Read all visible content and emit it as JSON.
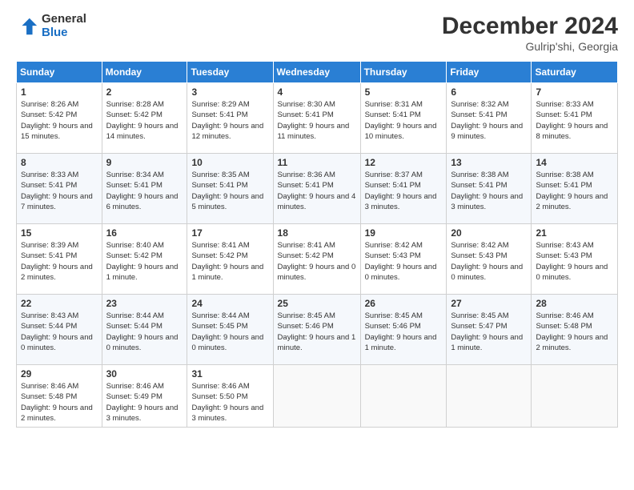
{
  "header": {
    "logo_general": "General",
    "logo_blue": "Blue",
    "month": "December 2024",
    "location": "Gulrip'shi, Georgia"
  },
  "days_of_week": [
    "Sunday",
    "Monday",
    "Tuesday",
    "Wednesday",
    "Thursday",
    "Friday",
    "Saturday"
  ],
  "weeks": [
    [
      {
        "day": "1",
        "sunrise": "8:26 AM",
        "sunset": "5:42 PM",
        "daylight": "9 hours and 15 minutes."
      },
      {
        "day": "2",
        "sunrise": "8:28 AM",
        "sunset": "5:42 PM",
        "daylight": "9 hours and 14 minutes."
      },
      {
        "day": "3",
        "sunrise": "8:29 AM",
        "sunset": "5:41 PM",
        "daylight": "9 hours and 12 minutes."
      },
      {
        "day": "4",
        "sunrise": "8:30 AM",
        "sunset": "5:41 PM",
        "daylight": "9 hours and 11 minutes."
      },
      {
        "day": "5",
        "sunrise": "8:31 AM",
        "sunset": "5:41 PM",
        "daylight": "9 hours and 10 minutes."
      },
      {
        "day": "6",
        "sunrise": "8:32 AM",
        "sunset": "5:41 PM",
        "daylight": "9 hours and 9 minutes."
      },
      {
        "day": "7",
        "sunrise": "8:33 AM",
        "sunset": "5:41 PM",
        "daylight": "9 hours and 8 minutes."
      }
    ],
    [
      {
        "day": "8",
        "sunrise": "8:33 AM",
        "sunset": "5:41 PM",
        "daylight": "9 hours and 7 minutes."
      },
      {
        "day": "9",
        "sunrise": "8:34 AM",
        "sunset": "5:41 PM",
        "daylight": "9 hours and 6 minutes."
      },
      {
        "day": "10",
        "sunrise": "8:35 AM",
        "sunset": "5:41 PM",
        "daylight": "9 hours and 5 minutes."
      },
      {
        "day": "11",
        "sunrise": "8:36 AM",
        "sunset": "5:41 PM",
        "daylight": "9 hours and 4 minutes."
      },
      {
        "day": "12",
        "sunrise": "8:37 AM",
        "sunset": "5:41 PM",
        "daylight": "9 hours and 3 minutes."
      },
      {
        "day": "13",
        "sunrise": "8:38 AM",
        "sunset": "5:41 PM",
        "daylight": "9 hours and 3 minutes."
      },
      {
        "day": "14",
        "sunrise": "8:38 AM",
        "sunset": "5:41 PM",
        "daylight": "9 hours and 2 minutes."
      }
    ],
    [
      {
        "day": "15",
        "sunrise": "8:39 AM",
        "sunset": "5:41 PM",
        "daylight": "9 hours and 2 minutes."
      },
      {
        "day": "16",
        "sunrise": "8:40 AM",
        "sunset": "5:42 PM",
        "daylight": "9 hours and 1 minute."
      },
      {
        "day": "17",
        "sunrise": "8:41 AM",
        "sunset": "5:42 PM",
        "daylight": "9 hours and 1 minute."
      },
      {
        "day": "18",
        "sunrise": "8:41 AM",
        "sunset": "5:42 PM",
        "daylight": "9 hours and 0 minutes."
      },
      {
        "day": "19",
        "sunrise": "8:42 AM",
        "sunset": "5:43 PM",
        "daylight": "9 hours and 0 minutes."
      },
      {
        "day": "20",
        "sunrise": "8:42 AM",
        "sunset": "5:43 PM",
        "daylight": "9 hours and 0 minutes."
      },
      {
        "day": "21",
        "sunrise": "8:43 AM",
        "sunset": "5:43 PM",
        "daylight": "9 hours and 0 minutes."
      }
    ],
    [
      {
        "day": "22",
        "sunrise": "8:43 AM",
        "sunset": "5:44 PM",
        "daylight": "9 hours and 0 minutes."
      },
      {
        "day": "23",
        "sunrise": "8:44 AM",
        "sunset": "5:44 PM",
        "daylight": "9 hours and 0 minutes."
      },
      {
        "day": "24",
        "sunrise": "8:44 AM",
        "sunset": "5:45 PM",
        "daylight": "9 hours and 0 minutes."
      },
      {
        "day": "25",
        "sunrise": "8:45 AM",
        "sunset": "5:46 PM",
        "daylight": "9 hours and 1 minute."
      },
      {
        "day": "26",
        "sunrise": "8:45 AM",
        "sunset": "5:46 PM",
        "daylight": "9 hours and 1 minute."
      },
      {
        "day": "27",
        "sunrise": "8:45 AM",
        "sunset": "5:47 PM",
        "daylight": "9 hours and 1 minute."
      },
      {
        "day": "28",
        "sunrise": "8:46 AM",
        "sunset": "5:48 PM",
        "daylight": "9 hours and 2 minutes."
      }
    ],
    [
      {
        "day": "29",
        "sunrise": "8:46 AM",
        "sunset": "5:48 PM",
        "daylight": "9 hours and 2 minutes."
      },
      {
        "day": "30",
        "sunrise": "8:46 AM",
        "sunset": "5:49 PM",
        "daylight": "9 hours and 3 minutes."
      },
      {
        "day": "31",
        "sunrise": "8:46 AM",
        "sunset": "5:50 PM",
        "daylight": "9 hours and 3 minutes."
      },
      null,
      null,
      null,
      null
    ]
  ]
}
